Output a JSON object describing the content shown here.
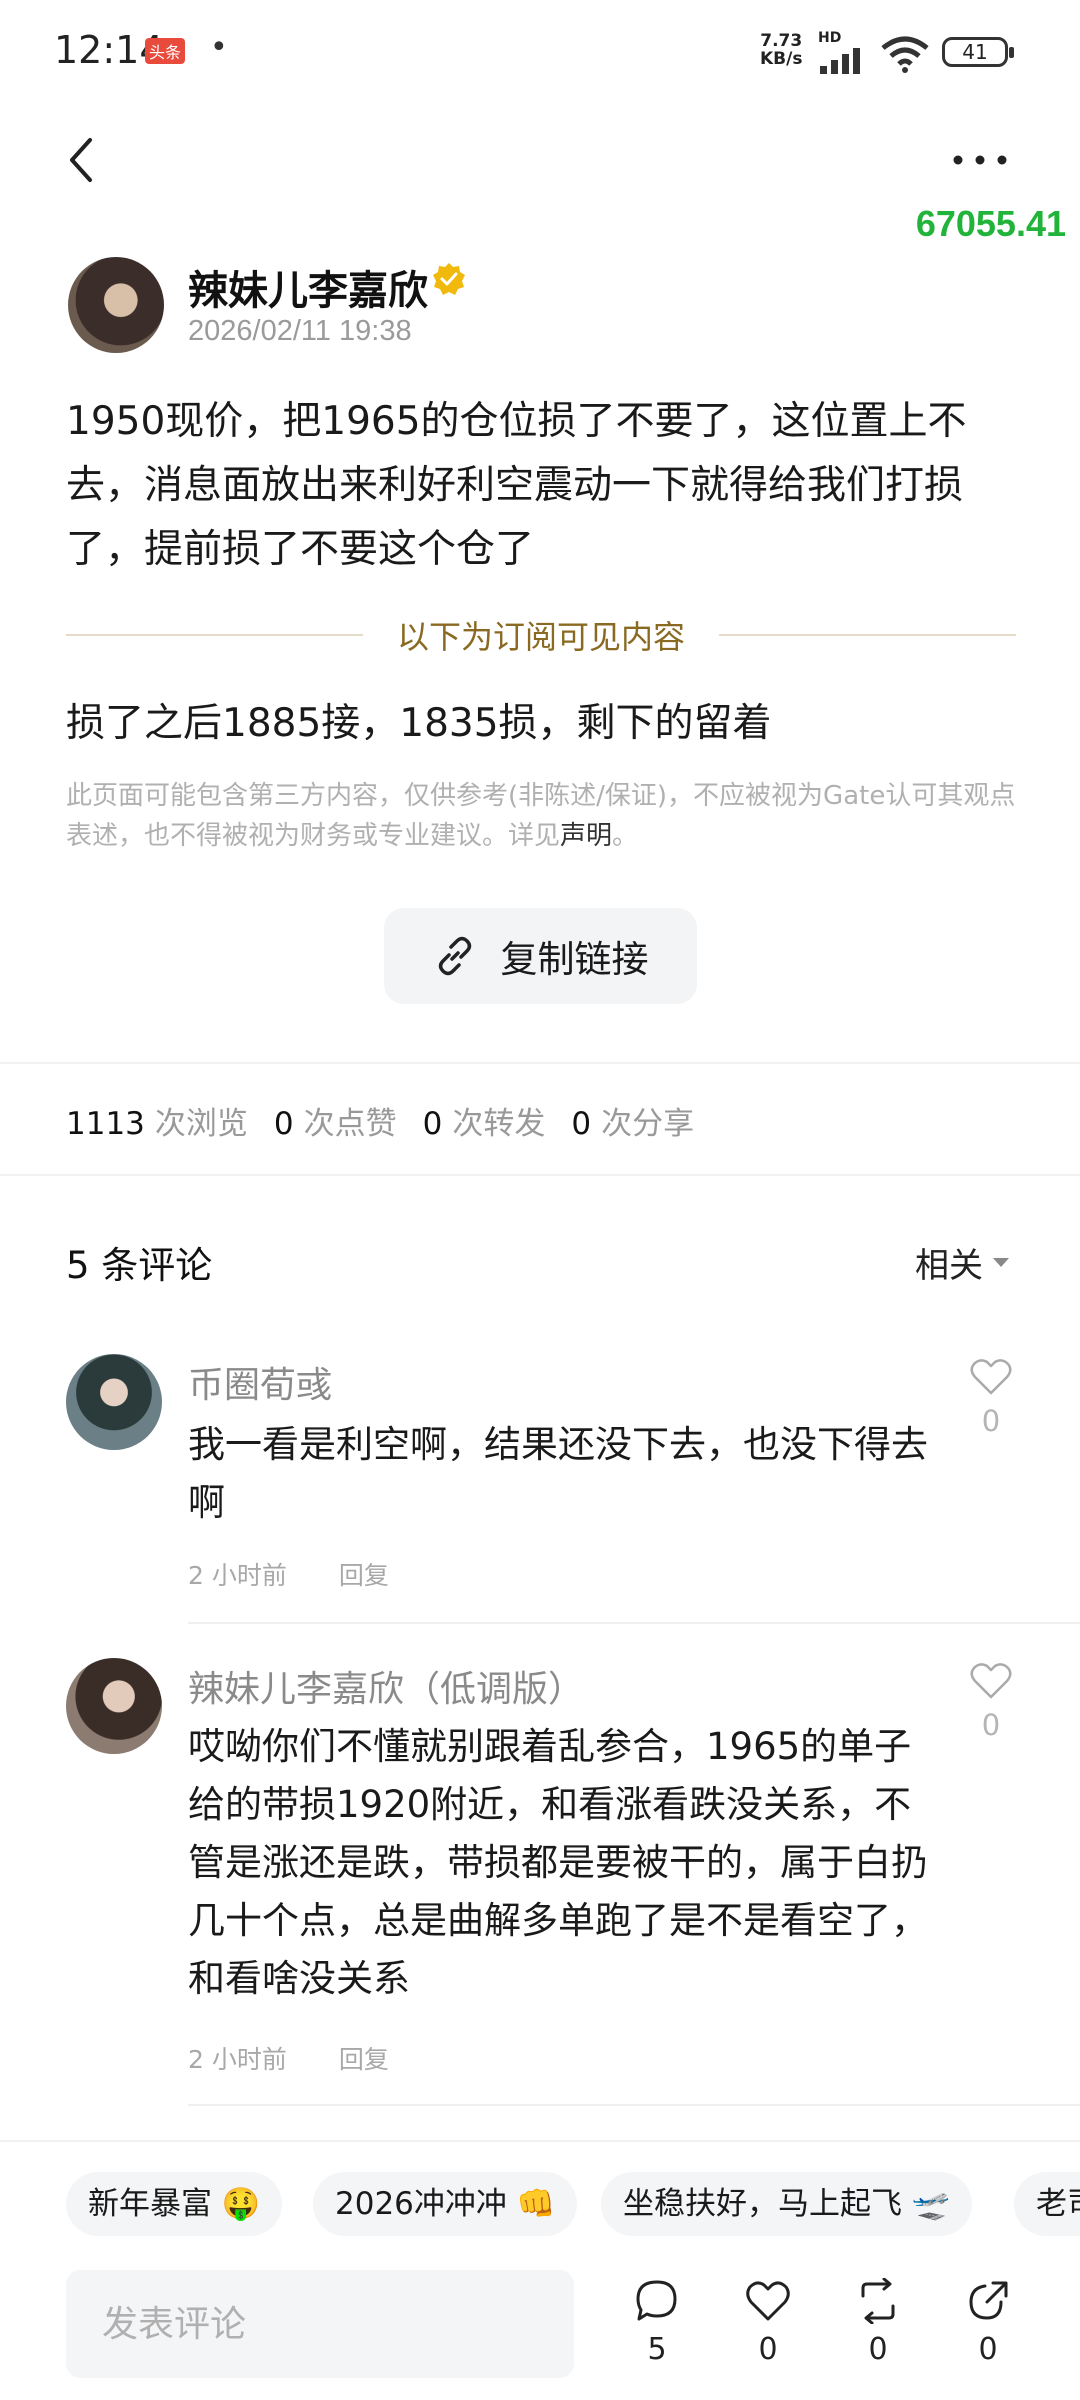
{
  "status_bar": {
    "time": "12:14",
    "badge": "头条",
    "dot": "•",
    "net_speed_value": "7.73",
    "net_speed_unit": "KB/s",
    "hd": "HD",
    "battery": "41"
  },
  "nav": {
    "back_icon": "chevron-left-icon",
    "more_icon": "more-dots-icon",
    "ticker": "67055.41",
    "ticker_color": "#22b43a"
  },
  "post": {
    "author": "辣妹儿李嘉欣",
    "date": "2026/02/11 19:38",
    "body": "1950现价，把1965的仓位损了不要了，这位置上不去，消息面放出来利好利空震动一下就得给我们打损了，提前损了不要这个仓了",
    "divider_label": "以下为订阅可见内容",
    "body_2": "损了之后1885接，1835损，剩下的留着",
    "disclaimer": "此页面可能包含第三方内容，仅供参考(非陈述/保证)，不应被视为Gate认可其观点表述，也不得被视为财务或专业建议。详见",
    "disclaimer_link": "声明",
    "disclaimer_end": "。",
    "copy_link": "复制链接"
  },
  "stats": {
    "views": "1113",
    "views_label": "次浏览",
    "likes": "0",
    "likes_label": "次点赞",
    "reposts": "0",
    "reposts_label": "次转发",
    "shares": "0",
    "shares_label": "次分享"
  },
  "comments_header": {
    "count_label": "5 条评论",
    "sort": "相关"
  },
  "comments": [
    {
      "name": "币圈荀彧",
      "text": "我一看是利空啊，结果还没下去，也没下得去啊",
      "time": "2 小时前",
      "reply": "回复",
      "likes": "0"
    },
    {
      "name": "辣妹儿李嘉欣（低调版）",
      "text": "哎呦你们不懂就别跟着乱参合，1965的单子给的带损1920附近，和看涨看跌没关系，不管是涨还是跌，带损都是要被干的，属于白扔几十个点，总是曲解多单跑了是不是看空了，和看啥没关系",
      "time": "2 小时前",
      "reply": "回复",
      "likes": "0"
    }
  ],
  "quick_replies": [
    "新年暴富 🤑",
    "2026冲冲冲 👊",
    "坐稳扶好，马上起飞 🛫",
    "老司"
  ],
  "composer": {
    "placeholder": "发表评论",
    "comment_count": "5",
    "like_count": "0",
    "repost_count": "0",
    "share_count": "0"
  }
}
